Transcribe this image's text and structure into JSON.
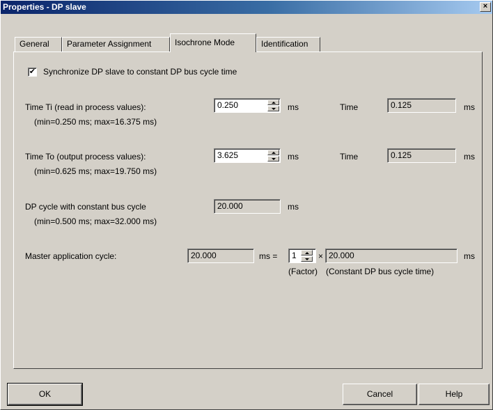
{
  "window": {
    "title": "Properties - DP slave",
    "close_glyph": "×"
  },
  "tabs": [
    {
      "label": "General"
    },
    {
      "label": "Parameter Assignment"
    },
    {
      "label": "Isochrone Mode"
    },
    {
      "label": "Identification"
    }
  ],
  "sync": {
    "checked": true,
    "check_glyph": "✔",
    "label": "Synchronize DP slave to constant DP bus cycle time"
  },
  "ti": {
    "label": "Time Ti (read in process values):",
    "range": "(min=0.250 ms; max=16.375 ms)",
    "value": "0.250",
    "unit": "ms",
    "time_label": "Time",
    "time_value": "0.125",
    "time_unit": "ms"
  },
  "to": {
    "label": "Time To (output process values):",
    "range": "(min=0.625 ms; max=19.750 ms)",
    "value": "3.625",
    "unit": "ms",
    "time_label": "Time",
    "time_value": "0.125",
    "time_unit": "ms"
  },
  "dp_cycle": {
    "label": "DP cycle with constant bus cycle",
    "range": "(min=0.500 ms; max=32.000 ms)",
    "value": "20.000",
    "unit": "ms"
  },
  "master": {
    "label": "Master application cycle:",
    "value": "20.000",
    "unit_eq": "ms =",
    "factor": "1",
    "times": "×",
    "bus_cycle": "20.000",
    "unit": "ms",
    "factor_caption": "(Factor)",
    "bus_caption": "(Constant DP bus cycle time)"
  },
  "buttons": {
    "ok": "OK",
    "cancel": "Cancel",
    "help": "Help"
  }
}
